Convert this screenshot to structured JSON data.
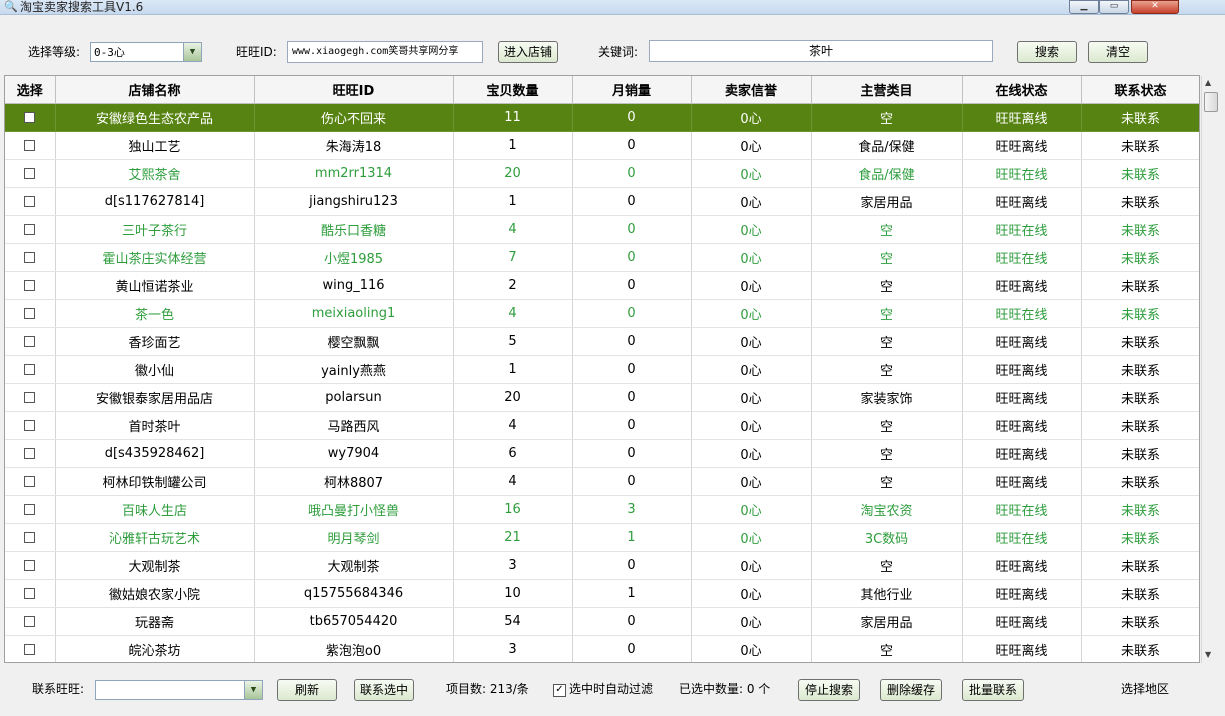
{
  "window": {
    "title": "淘宝卖家搜索工具V1.6"
  },
  "toolbar": {
    "level_label": "选择等级:",
    "level_value": "0-3心",
    "wangwang_label": "旺旺ID:",
    "wangwang_value": "www.xiaogegh.com笑哥共享网分享",
    "enter_shop": "进入店铺",
    "keyword_label": "关键词:",
    "keyword_value": "茶叶",
    "search": "搜索",
    "clear": "清空"
  },
  "table": {
    "headers": [
      "选择",
      "店铺名称",
      "旺旺ID",
      "宝贝数量",
      "月销量",
      "卖家信誉",
      "主营类目",
      "在线状态",
      "联系状态"
    ],
    "rows": [
      {
        "shop": "安徽绿色生态农产品",
        "id": "伤心不回来",
        "items": "11",
        "monthly": "0",
        "credit": "0心",
        "category": "空",
        "online": "旺旺离线",
        "contact": "未联系",
        "style": "sel"
      },
      {
        "shop": "独山工艺",
        "id": "朱海涛18",
        "items": "1",
        "monthly": "0",
        "credit": "0心",
        "category": "食品/保健",
        "online": "旺旺离线",
        "contact": "未联系",
        "style": ""
      },
      {
        "shop": "艾熙茶舍",
        "id": "mm2rr1314",
        "items": "20",
        "monthly": "0",
        "credit": "0心",
        "category": "食品/保健",
        "online": "旺旺在线",
        "contact": "未联系",
        "style": "green"
      },
      {
        "shop": "d[s117627814]",
        "id": "jiangshiru123",
        "items": "1",
        "monthly": "0",
        "credit": "0心",
        "category": "家居用品",
        "online": "旺旺离线",
        "contact": "未联系",
        "style": ""
      },
      {
        "shop": "三叶子茶行",
        "id": "酷乐口香糖",
        "items": "4",
        "monthly": "0",
        "credit": "0心",
        "category": "空",
        "online": "旺旺在线",
        "contact": "未联系",
        "style": "green"
      },
      {
        "shop": "霍山茶庄实体经营",
        "id": "小煜1985",
        "items": "7",
        "monthly": "0",
        "credit": "0心",
        "category": "空",
        "online": "旺旺在线",
        "contact": "未联系",
        "style": "green"
      },
      {
        "shop": "黄山恒诺茶业",
        "id": "wing_116",
        "items": "2",
        "monthly": "0",
        "credit": "0心",
        "category": "空",
        "online": "旺旺离线",
        "contact": "未联系",
        "style": ""
      },
      {
        "shop": "茶一色",
        "id": "meixiaoling1",
        "items": "4",
        "monthly": "0",
        "credit": "0心",
        "category": "空",
        "online": "旺旺在线",
        "contact": "未联系",
        "style": "green"
      },
      {
        "shop": "香珍面艺",
        "id": "樱空飘飘",
        "items": "5",
        "monthly": "0",
        "credit": "0心",
        "category": "空",
        "online": "旺旺离线",
        "contact": "未联系",
        "style": ""
      },
      {
        "shop": "徽小仙",
        "id": "yainly燕燕",
        "items": "1",
        "monthly": "0",
        "credit": "0心",
        "category": "空",
        "online": "旺旺离线",
        "contact": "未联系",
        "style": ""
      },
      {
        "shop": "安徽银泰家居用品店",
        "id": "polarsun",
        "items": "20",
        "monthly": "0",
        "credit": "0心",
        "category": "家装家饰",
        "online": "旺旺离线",
        "contact": "未联系",
        "style": ""
      },
      {
        "shop": "首时茶叶",
        "id": "马路西风",
        "items": "4",
        "monthly": "0",
        "credit": "0心",
        "category": "空",
        "online": "旺旺离线",
        "contact": "未联系",
        "style": ""
      },
      {
        "shop": "d[s435928462]",
        "id": "wy7904",
        "items": "6",
        "monthly": "0",
        "credit": "0心",
        "category": "空",
        "online": "旺旺离线",
        "contact": "未联系",
        "style": ""
      },
      {
        "shop": "柯林印铁制罐公司",
        "id": "柯林8807",
        "items": "4",
        "monthly": "0",
        "credit": "0心",
        "category": "空",
        "online": "旺旺离线",
        "contact": "未联系",
        "style": ""
      },
      {
        "shop": "百味人生店",
        "id": "哦凸曼打小怪兽",
        "items": "16",
        "monthly": "3",
        "credit": "0心",
        "category": "淘宝农资",
        "online": "旺旺在线",
        "contact": "未联系",
        "style": "green"
      },
      {
        "shop": "沁雅轩古玩艺术",
        "id": "明月琴剑",
        "items": "21",
        "monthly": "1",
        "credit": "0心",
        "category": "3C数码",
        "online": "旺旺在线",
        "contact": "未联系",
        "style": "green"
      },
      {
        "shop": "大观制茶",
        "id": "大观制茶",
        "items": "3",
        "monthly": "0",
        "credit": "0心",
        "category": "空",
        "online": "旺旺离线",
        "contact": "未联系",
        "style": ""
      },
      {
        "shop": "徽姑娘农家小院",
        "id": "q15755684346",
        "items": "10",
        "monthly": "1",
        "credit": "0心",
        "category": "其他行业",
        "online": "旺旺离线",
        "contact": "未联系",
        "style": ""
      },
      {
        "shop": "玩器斋",
        "id": "tb657054420",
        "items": "54",
        "monthly": "0",
        "credit": "0心",
        "category": "家居用品",
        "online": "旺旺离线",
        "contact": "未联系",
        "style": ""
      },
      {
        "shop": "皖沁茶坊",
        "id": "紫泡泡o0",
        "items": "3",
        "monthly": "0",
        "credit": "0心",
        "category": "空",
        "online": "旺旺离线",
        "contact": "未联系",
        "style": ""
      }
    ]
  },
  "bottom": {
    "contact_label": "联系旺旺:",
    "contact_value": "",
    "refresh": "刷新",
    "contact_selected": "联系选中",
    "item_count": "项目数: 213/条",
    "auto_filter": "选中时自动过滤",
    "auto_filter_checked": true,
    "selected_count": "已选中数量: 0 个",
    "stop_search": "停止搜索",
    "delete_cache": "删除缓存",
    "batch_contact": "批量联系",
    "select_region": "选择地区"
  }
}
